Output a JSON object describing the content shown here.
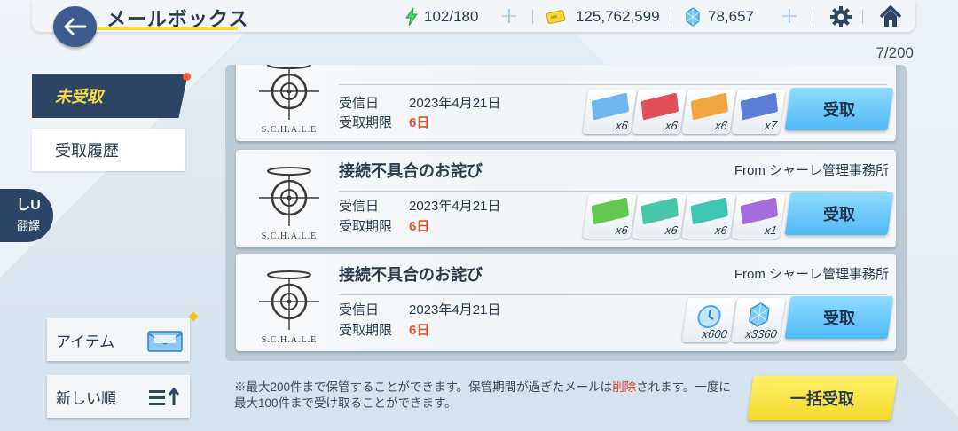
{
  "header": {
    "title": "メールボックス",
    "ap": "102/180",
    "credits": "125,762,599",
    "pyroxene": "78,657"
  },
  "mail_count": "7/200",
  "tabs": {
    "unclaimed": "未受取",
    "history": "受取履歴"
  },
  "translate": {
    "icon_text": "しU",
    "label": "翻譯"
  },
  "filters": {
    "item_label": "アイテム",
    "sort_label": "新しい順"
  },
  "labels": {
    "received": "受信日",
    "expires": "受取期限",
    "claim": "受取"
  },
  "mails": [
    {
      "subject": "",
      "from": "",
      "logo_text": "S.C.H.A.L.E",
      "received": "2023年4月21日",
      "expires": "6日",
      "rewards": [
        {
          "icon": "skill-report-icon",
          "color": "#6fb6f0",
          "qty": "x6"
        },
        {
          "icon": "tech-note-red-icon",
          "color": "#e0505a",
          "qty": "x6"
        },
        {
          "icon": "tech-note-orange-icon",
          "color": "#f3a443",
          "qty": "x6"
        },
        {
          "icon": "tech-note-blue-icon",
          "color": "#5b7fd6",
          "qty": "x7"
        }
      ]
    },
    {
      "subject": "接続不具合のお詫び",
      "from": "From シャーレ管理事務所",
      "logo_text": "S.C.H.A.L.E",
      "received": "2023年4月21日",
      "expires": "6日",
      "rewards": [
        {
          "icon": "ticket-green-icon",
          "color": "#63c84f",
          "qty": "x6"
        },
        {
          "icon": "ticket-teal-icon",
          "color": "#48c6a8",
          "qty": "x6"
        },
        {
          "icon": "ticket-cyan-icon",
          "color": "#3ec7b2",
          "qty": "x6"
        },
        {
          "icon": "ticket-purple-icon",
          "color": "#a46bdc",
          "qty": "x1"
        }
      ]
    },
    {
      "subject": "接続不具合のお詫び",
      "from": "From シャーレ管理事務所",
      "logo_text": "S.C.H.A.L.E",
      "received": "2023年4月21日",
      "expires": "6日",
      "rewards": [
        {
          "icon": "ap-clock-icon",
          "color": "#7fc7ec",
          "qty": "x600"
        },
        {
          "icon": "pyroxene-icon",
          "color": "#5fb4ee",
          "qty": "x3360"
        }
      ]
    }
  ],
  "notice": {
    "part1": "※最大200件まで保管することができます。保管期間が過ぎたメールは",
    "highlight": "削除",
    "part2": "されます。一度に最大100件まで受け取ることができます。"
  },
  "bulk_claim": "一括受取",
  "colors": {
    "accent_yellow": "#f4d92c",
    "claim_blue": "#4fb9f3",
    "tab_dark": "#2d4464",
    "expire_red": "#e0552b"
  }
}
